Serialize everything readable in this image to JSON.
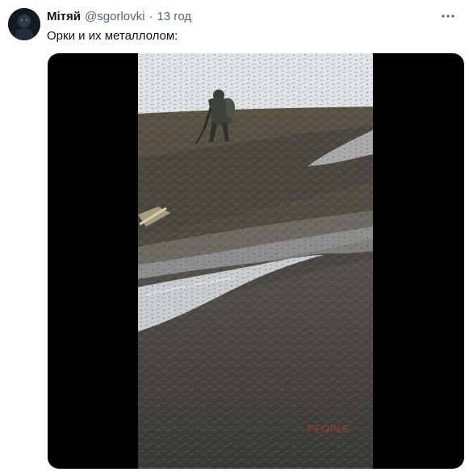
{
  "tweet": {
    "display_name": "Мітяй",
    "handle": "@sgorlovki",
    "separator": "·",
    "time": "13 год",
    "text": "Орки и их металлолом:"
  },
  "icons": {
    "more": "more-horizontal-icon",
    "avatar": "avatar-image"
  },
  "media": {
    "type": "video",
    "content": "soldier-in-muddy-field"
  },
  "colors": {
    "name": "#0f1419",
    "secondary": "#536471",
    "media_background": "#000000",
    "sky": "#d9dde0",
    "mud": "#4b4840",
    "water": "#c9cdd0"
  }
}
